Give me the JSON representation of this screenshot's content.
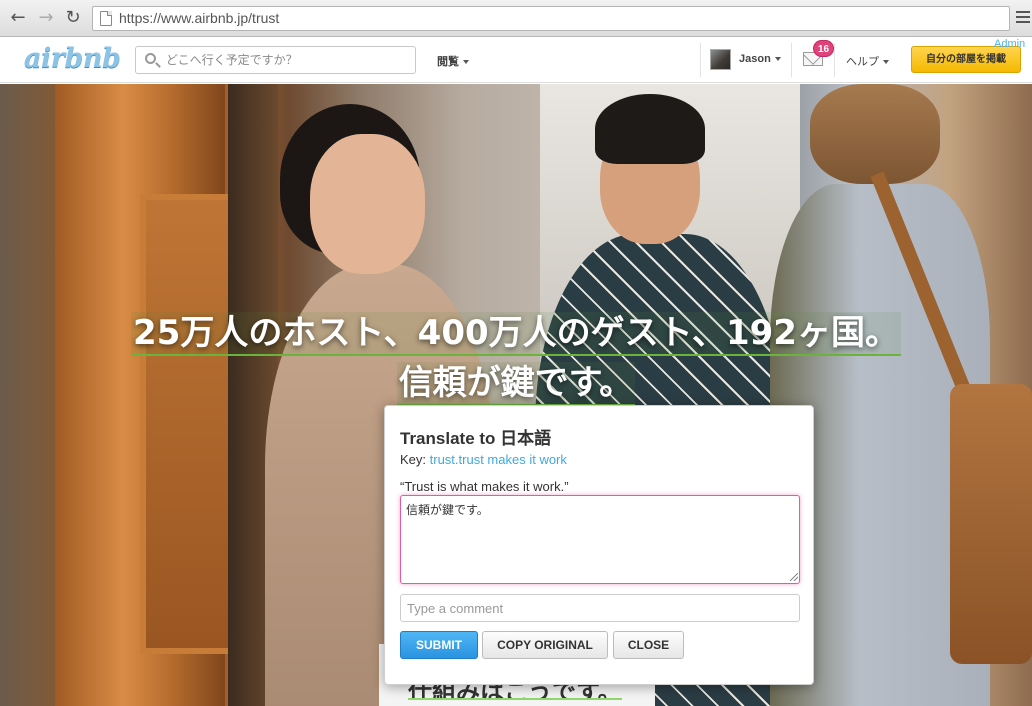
{
  "browser": {
    "url": "https://www.airbnb.jp/trust",
    "back_icon": "arrow-left",
    "forward_icon": "arrow-right",
    "reload_icon": "reload"
  },
  "header": {
    "logo_text": "airbnb",
    "search_placeholder": "どこへ行く予定ですか？",
    "browse_label": "閲覧",
    "user_name": "Jason",
    "unread_count": "16",
    "help_label": "ヘルプ",
    "list_space_label": "自分の部屋を掲載",
    "admin_label": "Admin",
    "accent_color": "#f5b800",
    "badge_color": "#e0427a"
  },
  "hero": {
    "headline_line1": "25万人のホスト、400万人のゲスト、192ヶ国。",
    "headline_line2": "信頼が鍵です。",
    "subtext_partial": "仕組みはこうです。"
  },
  "dialog": {
    "title": "Translate to 日本語",
    "key_label": "Key:",
    "key_value": "trust.trust makes it work",
    "original_text": "“Trust is what makes it work.”",
    "translation_value": "信頼が鍵です。",
    "comment_placeholder": "Type a comment",
    "submit_label": "SUBMIT",
    "copy_original_label": "COPY ORIGINAL",
    "close_label": "CLOSE",
    "focus_color": "#e05ca8",
    "link_color": "#3fa9df"
  }
}
